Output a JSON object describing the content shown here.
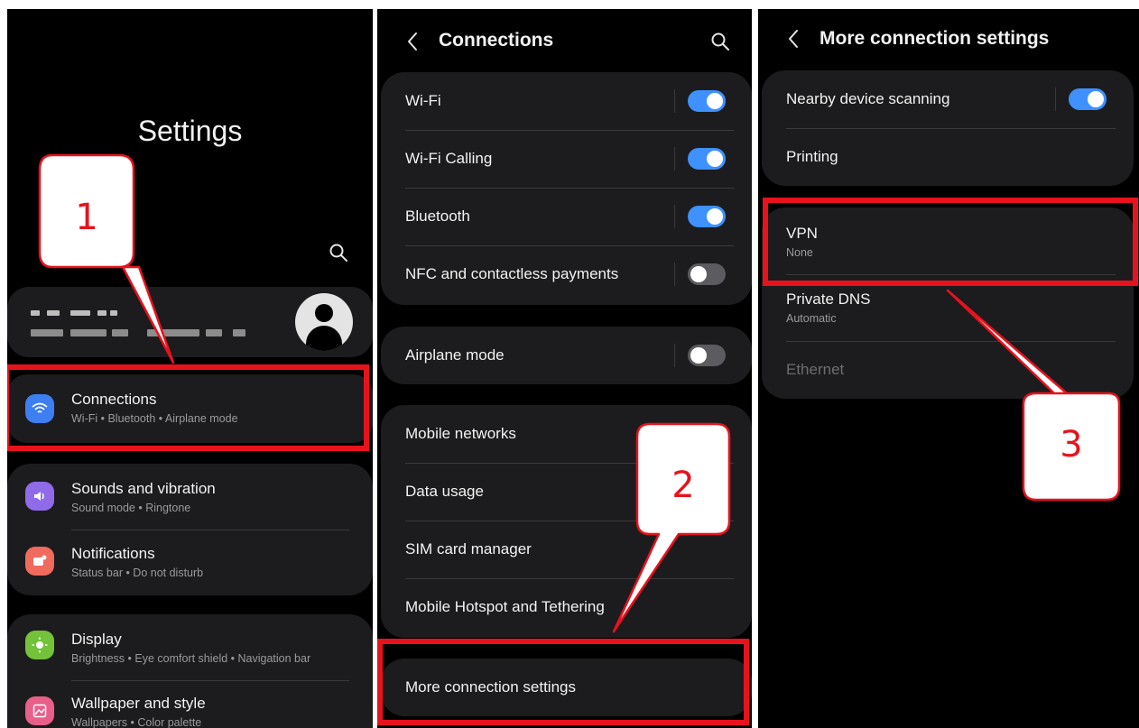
{
  "panel1": {
    "title": "Settings",
    "items": [
      {
        "label": "Connections",
        "sub": "Wi-Fi  •  Bluetooth  •  Airplane mode",
        "icon": "wifi-icon",
        "color": "#3d7ff0"
      },
      {
        "label": "Sounds and vibration",
        "sub": "Sound mode  •  Ringtone",
        "icon": "volume-icon",
        "color": "#8f6bea"
      },
      {
        "label": "Notifications",
        "sub": "Status bar  •  Do not disturb",
        "icon": "notification-icon",
        "color": "#f06a5d"
      },
      {
        "label": "Display",
        "sub": "Brightness  •  Eye comfort shield  •  Navigation bar",
        "icon": "sun-icon",
        "color": "#73c23a"
      },
      {
        "label": "Wallpaper and style",
        "sub": "Wallpapers  •  Color palette",
        "icon": "wallpaper-icon",
        "color": "#e85f8a"
      }
    ]
  },
  "panel2": {
    "title": "Connections",
    "group1": [
      {
        "label": "Wi-Fi",
        "toggle": true
      },
      {
        "label": "Wi-Fi Calling",
        "toggle": true
      },
      {
        "label": "Bluetooth",
        "toggle": true
      },
      {
        "label": "NFC and contactless payments",
        "toggle": false
      }
    ],
    "airplane": {
      "label": "Airplane mode",
      "toggle": false
    },
    "group3": [
      "Mobile networks",
      "Data usage",
      "SIM card manager",
      "Mobile Hotspot and Tethering"
    ],
    "more": "More connection settings"
  },
  "panel3": {
    "title": "More connection settings",
    "nearby": {
      "label": "Nearby device scanning",
      "toggle": true
    },
    "printing": "Printing",
    "vpn": {
      "label": "VPN",
      "sub": "None"
    },
    "dns": {
      "label": "Private DNS",
      "sub": "Automatic"
    },
    "ethernet": "Ethernet"
  },
  "callouts": [
    "1",
    "2",
    "3"
  ],
  "colors": {
    "highlight": "#e8121d",
    "toggle_on": "#3e91ff",
    "card": "#1c1c1e"
  }
}
